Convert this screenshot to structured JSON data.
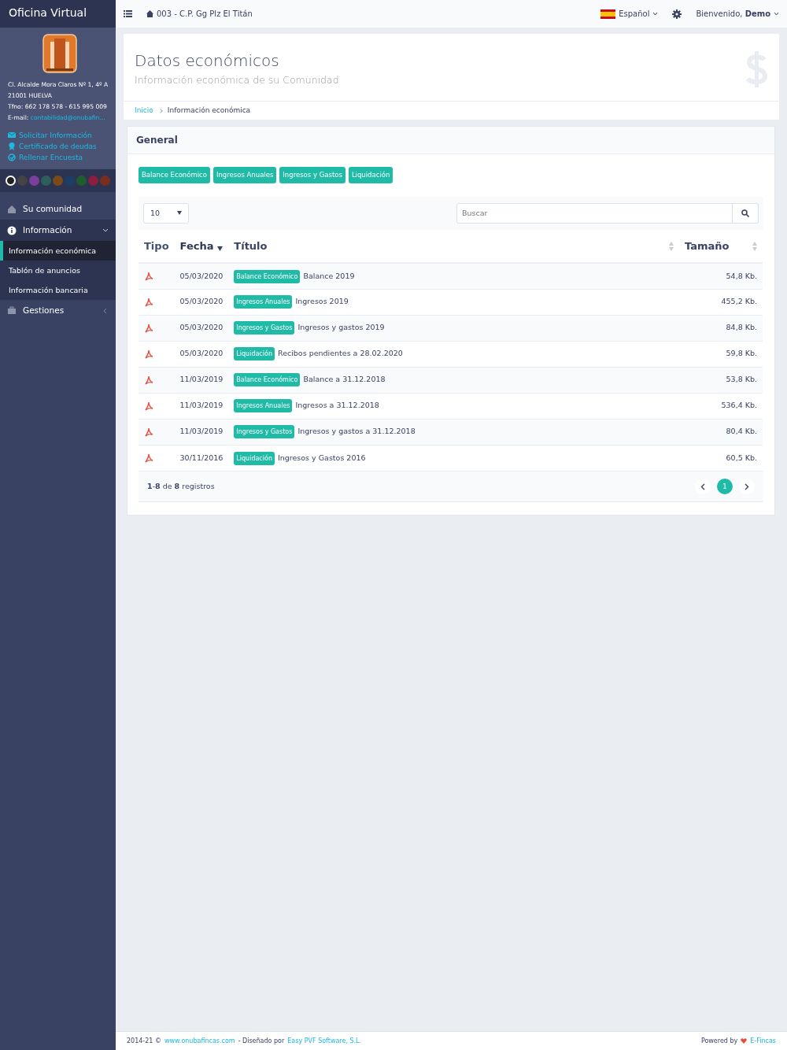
{
  "sidebar": {
    "brand": "Oficina Virtual",
    "address_lines": [
      "Cl. Alcalde Mora Claros Nº 1, 4º A",
      "21001 HUELVA",
      "Tfno: 662 178 578 - 615 995 009"
    ],
    "email_label": "E-mail:",
    "email": "contabilidad@onubafin...",
    "links": [
      {
        "label": "Solicitar Información",
        "kind": "mail"
      },
      {
        "label": "Certificado de deudas",
        "kind": "award"
      },
      {
        "label": "Rellenar Encuesta",
        "kind": "check"
      }
    ],
    "themes": [
      {
        "color": "#222222",
        "selected": true
      },
      {
        "color": "#444444",
        "selected": false
      },
      {
        "color": "#7b3f9e",
        "selected": false
      },
      {
        "color": "#2f5f5a",
        "selected": false
      },
      {
        "color": "#7a4a1a",
        "selected": false
      },
      {
        "color": "#1b3f66",
        "selected": false
      },
      {
        "color": "#1e5e2e",
        "selected": false
      },
      {
        "color": "#8a1f3f",
        "selected": false
      },
      {
        "color": "#7a2e1e",
        "selected": false
      }
    ],
    "menu": [
      {
        "label": "Su comunidad",
        "kind": "home",
        "expanded": false
      },
      {
        "label": "Información",
        "kind": "info",
        "expanded": true,
        "children": [
          {
            "label": "Información económica",
            "selected": true
          },
          {
            "label": "Tablón de anuncios",
            "selected": false
          },
          {
            "label": "Información bancaria",
            "selected": false
          }
        ]
      },
      {
        "label": "Gestiones",
        "kind": "briefcase",
        "expanded": false
      }
    ]
  },
  "topbar": {
    "community": "003 - C.P. Gg Plz El Titán",
    "language": "Español",
    "greeting": "Bienvenido, **Demo**"
  },
  "header": {
    "title": "Datos económicos",
    "subtitle": "Información económica de su Comunidad",
    "breadcrumb": [
      "Inicio",
      "Información económica"
    ]
  },
  "panel": {
    "title": "General",
    "filters": [
      "Balance Económico",
      "Ingresos Anuales",
      "Ingresos y Gastos",
      "Liquidación"
    ],
    "page_length": "10",
    "search": {
      "placeholder": "Buscar"
    },
    "columns": [
      {
        "label": "Tipo",
        "sortable": false,
        "sorted": false
      },
      {
        "label": "Fecha",
        "sortable": true,
        "sorted": true
      },
      {
        "label": "Título",
        "sortable": true,
        "sorted": false
      },
      {
        "label": "Tamaño",
        "sortable": true,
        "sorted": false
      }
    ],
    "rows": [
      {
        "date": "05/03/2020",
        "tag": "Balance Económico",
        "title": "Balance 2019",
        "size": "54,8 Kb."
      },
      {
        "date": "05/03/2020",
        "tag": "Ingresos Anuales",
        "title": "Ingresos 2019",
        "size": "455,2 Kb."
      },
      {
        "date": "05/03/2020",
        "tag": "Ingresos y Gastos",
        "title": "Ingresos y gastos 2019",
        "size": "84,8 Kb."
      },
      {
        "date": "05/03/2020",
        "tag": "Liquidación",
        "title": "Recibos pendientes a 28.02.2020",
        "size": "59,8 Kb."
      },
      {
        "date": "11/03/2019",
        "tag": "Balance Económico",
        "title": "Balance a 31.12.2018",
        "size": "53,8 Kb."
      },
      {
        "date": "11/03/2019",
        "tag": "Ingresos Anuales",
        "title": "Ingresos a 31.12.2018",
        "size": "536,4 Kb."
      },
      {
        "date": "11/03/2019",
        "tag": "Ingresos y Gastos",
        "title": "Ingresos y gastos a 31.12.2018",
        "size": "80,4 Kb."
      },
      {
        "date": "30/11/2016",
        "tag": "Liquidación",
        "title": "Ingresos y Gastos 2016",
        "size": "60,5 Kb."
      }
    ],
    "info": "**1**-**8** de **8** registros",
    "pages": [
      {
        "label": "1",
        "selected": true
      }
    ]
  },
  "footer": {
    "left": [
      "2014-21 ©",
      "www.onubafincas.com",
      "- Diseñado por",
      "Easy PVF Software, S.L."
    ],
    "powered": "Powered by",
    "brand": "E-Fincas"
  }
}
